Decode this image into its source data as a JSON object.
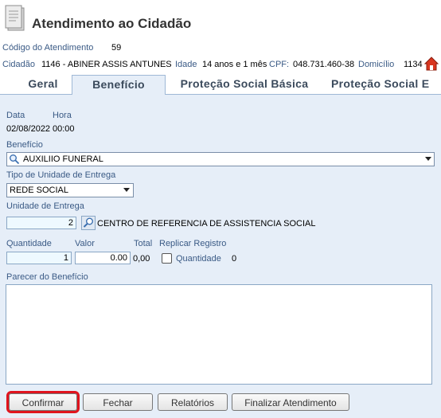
{
  "header": {
    "title": "Atendimento ao Cidadão",
    "codigo_label": "Código do Atendimento",
    "codigo_value": "59",
    "cidadao_label": "Cidadão",
    "cidadao_value": "1146 - ABINER ASSIS ANTUNES",
    "idade_label": "Idade",
    "idade_value": "14 anos e 1 mês",
    "cpf_label": "CPF:",
    "cpf_value": "048.731.460-38",
    "domicilio_label": "Domicílio",
    "domicilio_value": "1134"
  },
  "tabs": [
    {
      "label": "Geral"
    },
    {
      "label": "Benefício"
    },
    {
      "label": "Proteção Social Básica"
    },
    {
      "label": "Proteção Social E"
    }
  ],
  "form": {
    "data_label": "Data",
    "hora_label": "Hora",
    "data_value": "02/08/2022",
    "hora_value": "00:00",
    "beneficio_label": "Benefício",
    "beneficio_value": "AUXILIIO FUNERAL",
    "tipo_unidade_label": "Tipo de Unidade de Entrega",
    "tipo_unidade_value": "REDE SOCIAL",
    "unidade_label": "Unidade de Entrega",
    "unidade_code": "2",
    "unidade_name": "CENTRO DE REFERENCIA DE ASSISTENCIA SOCIAL",
    "quantidade_label": "Quantidade",
    "valor_label": "Valor",
    "total_label": "Total",
    "replicar_label": "Replicar Registro",
    "quantidade_value": "1",
    "valor_value": "0.00",
    "total_value": "0,00",
    "replicar_quantidade_label": "Quantidade",
    "replicar_quantidade_value": "0",
    "parecer_label": "Parecer do Benefício",
    "parecer_value": ""
  },
  "buttons": {
    "confirmar": "Confirmar",
    "fechar": "Fechar",
    "relatorios": "Relatórios",
    "finalizar": "Finalizar Atendimento"
  },
  "colors": {
    "label_blue": "#3a5a85",
    "panel_bg": "#e6eef8",
    "field_bg": "#eef9ff",
    "highlight_red": "#e0141e",
    "home_icon_red": "#d9361f"
  }
}
